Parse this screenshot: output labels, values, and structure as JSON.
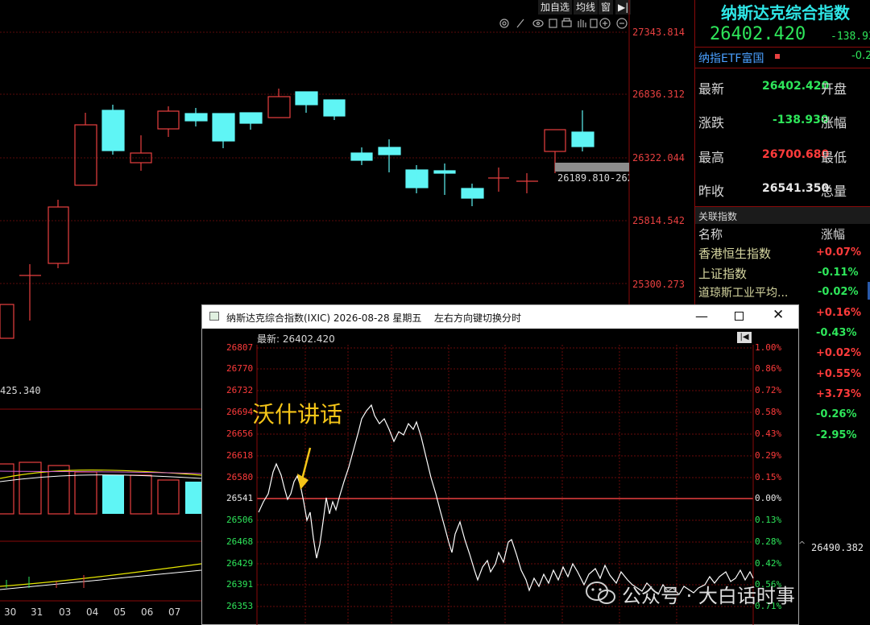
{
  "toolbar": {
    "add_watchlist": "加自选",
    "moving_avg": "均线",
    "window": "窗",
    "arrow": "▶|"
  },
  "main_chart": {
    "y_labels": [
      "27343.814",
      "26836.312",
      "26322.044",
      "25814.542",
      "25300.273"
    ],
    "low_marker": "26189.810-262",
    "left_value": "425.340",
    "dates": [
      "30",
      "31",
      "03",
      "04",
      "05",
      "06",
      "07"
    ],
    "right_value": "26490.382"
  },
  "quote": {
    "title": "纳斯达克综合指数",
    "price": "26402.420",
    "change": "-138.93",
    "etf_name": "纳指ETF富国",
    "etf_change": "-0.2",
    "rows": [
      {
        "label": "最新",
        "value": "26402.420",
        "value_color": "#2ee65a",
        "label2": "开盘"
      },
      {
        "label": "涨跌",
        "value": "-138.930",
        "value_color": "#2ee65a",
        "label2": "涨幅"
      },
      {
        "label": "最高",
        "value": "26700.680",
        "value_color": "#ff3b3b",
        "label2": "最低"
      },
      {
        "label": "昨收",
        "value": "26541.350",
        "value_color": "#e8e8e8",
        "label2": "总量"
      }
    ]
  },
  "related": {
    "title": "关联指数",
    "col_name": "名称",
    "col_change": "涨幅",
    "items": [
      {
        "name": "香港恒生指数",
        "change": "+0.07%",
        "up": true
      },
      {
        "name": "上证指数",
        "change": "-0.11%",
        "up": false
      },
      {
        "name": "道琼斯工业平均...",
        "change": "-0.02%",
        "up": false
      }
    ],
    "more_changes": [
      {
        "change": "+0.16%",
        "up": true
      },
      {
        "change": "-0.43%",
        "up": false
      },
      {
        "change": "+0.02%",
        "up": true
      },
      {
        "change": "+0.55%",
        "up": true
      },
      {
        "change": "+3.73%",
        "up": true
      },
      {
        "change": "-0.26%",
        "up": false
      },
      {
        "change": "-2.95%",
        "up": false
      }
    ]
  },
  "popup": {
    "title": "纳斯达克综合指数(IXIC) 2026-08-28 星期五",
    "hint": "左右方向键切换分时",
    "latest_label": "最新: 26402.420",
    "annotation": "沃什讲话",
    "y_left": [
      "26807",
      "26770",
      "26732",
      "26694",
      "26656",
      "26618",
      "26580",
      "26541",
      "26506",
      "26468",
      "26429",
      "26391",
      "26353"
    ],
    "y_right": [
      "1.00%",
      "0.86%",
      "0.72%",
      "0.58%",
      "0.43%",
      "0.29%",
      "0.15%",
      "0.00%",
      "0.13%",
      "0.28%",
      "0.42%",
      "0.56%",
      "0.71%"
    ],
    "colors": {
      "up": "#ff3b3b",
      "down": "#2ee65a",
      "line": "#ffffff",
      "annotation": "#f5c518"
    }
  },
  "watermark": {
    "text": "公众号 · 大白话时事"
  }
}
